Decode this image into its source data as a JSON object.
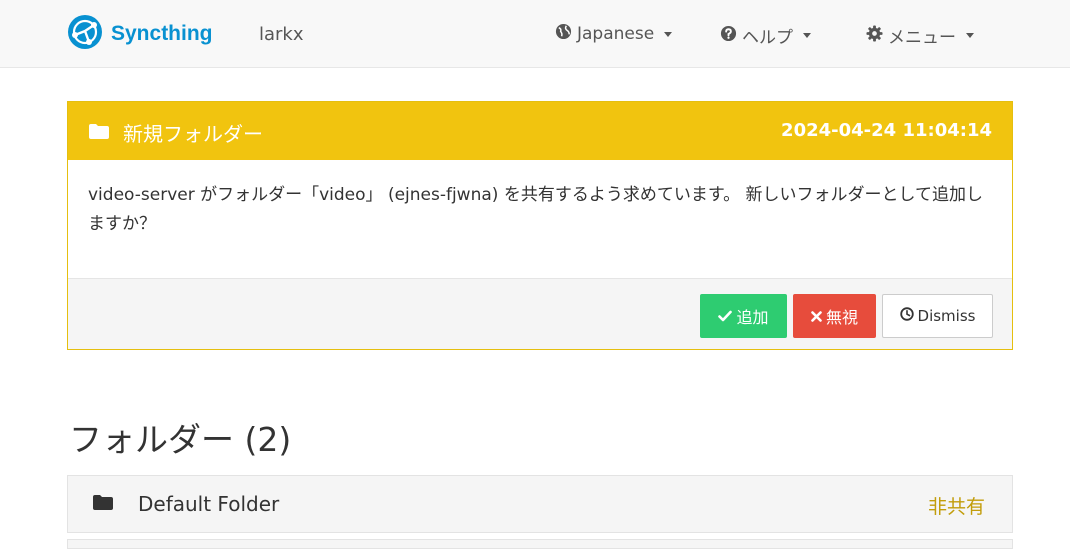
{
  "navbar": {
    "brand": "Syncthing",
    "device_name": "larkx",
    "language": "Japanese",
    "help": "ヘルプ",
    "menu": "メニュー"
  },
  "notification": {
    "title": "新規フォルダー",
    "timestamp": "2024-04-24 11:04:14",
    "message": "video-server がフォルダー「video」 (ejnes-fjwna) を共有するよう求めています。 新しいフォルダーとして追加しますか？",
    "buttons": {
      "add": "追加",
      "ignore": "無視",
      "dismiss": "Dismiss"
    }
  },
  "folders": {
    "heading": "フォルダー (2)",
    "items": [
      {
        "label": "Default Folder",
        "status": "非共有"
      }
    ]
  },
  "colors": {
    "brand": "#0891d1",
    "panel_header": "#f1c40f",
    "add": "#2ecc71",
    "ignore": "#e74c3c",
    "unshared": "#c29d0b"
  }
}
